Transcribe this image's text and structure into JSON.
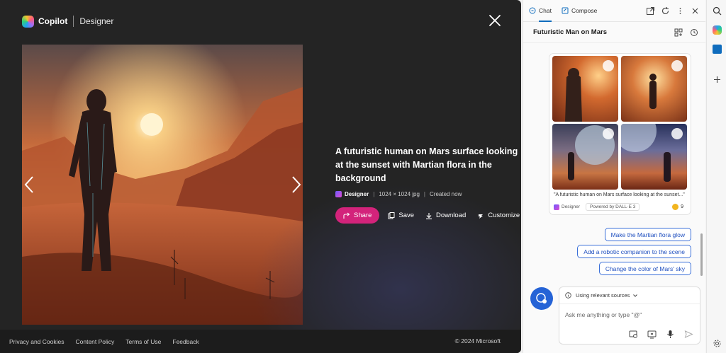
{
  "designer": {
    "brand": "Copilot",
    "product": "Designer",
    "image_title": "A futuristic human on Mars surface looking at the sunset with Martian flora in the background",
    "meta_source": "Designer",
    "meta_size": "1024 × 1024 jpg",
    "meta_status": "Created now",
    "actions": {
      "share": "Share",
      "save": "Save",
      "download": "Download",
      "customize": "Customize"
    }
  },
  "footer": {
    "links": [
      "Privacy and Cookies",
      "Content Policy",
      "Terms of Use",
      "Feedback"
    ],
    "copyright": "© 2024 Microsoft"
  },
  "chat": {
    "tabs": [
      {
        "label": "Chat",
        "active": true
      },
      {
        "label": "Compose",
        "active": false
      }
    ],
    "conversation_title": "Futuristic Man on Mars",
    "card": {
      "caption": "\"A futuristic human on Mars surface looking at the sunset...\"",
      "source": "Designer",
      "powered": "Powered by DALL·E 3",
      "boosts": "9"
    },
    "suggestions": [
      "Make the Martian flora glow",
      "Add a robotic companion to the scene",
      "Change the color of Mars' sky"
    ],
    "source_mode": "Using relevant sources",
    "input_placeholder": "Ask me anything or type \"@\""
  },
  "icons": {
    "close": "close-icon",
    "prev": "chevron-left-icon",
    "next": "chevron-right-icon",
    "share": "share-icon",
    "save": "save-icon",
    "download": "download-icon",
    "customize": "customize-icon",
    "tab_tools": [
      "open-new-tab-icon",
      "refresh-icon",
      "more-icon",
      "close-icon"
    ],
    "conv_tools": [
      "collection-icon",
      "history-icon"
    ],
    "rail": [
      "search-icon",
      "copilot-icon",
      "outlook-icon",
      "add-icon",
      "settings-icon"
    ],
    "input_tools": [
      "image-search-icon",
      "screenshot-icon",
      "microphone-icon",
      "send-icon"
    ]
  },
  "colors": {
    "accent_pink": "#d3237b",
    "link_blue": "#1f4fbf",
    "chat_blue": "#2563d6",
    "dark_panel": "#242424"
  }
}
